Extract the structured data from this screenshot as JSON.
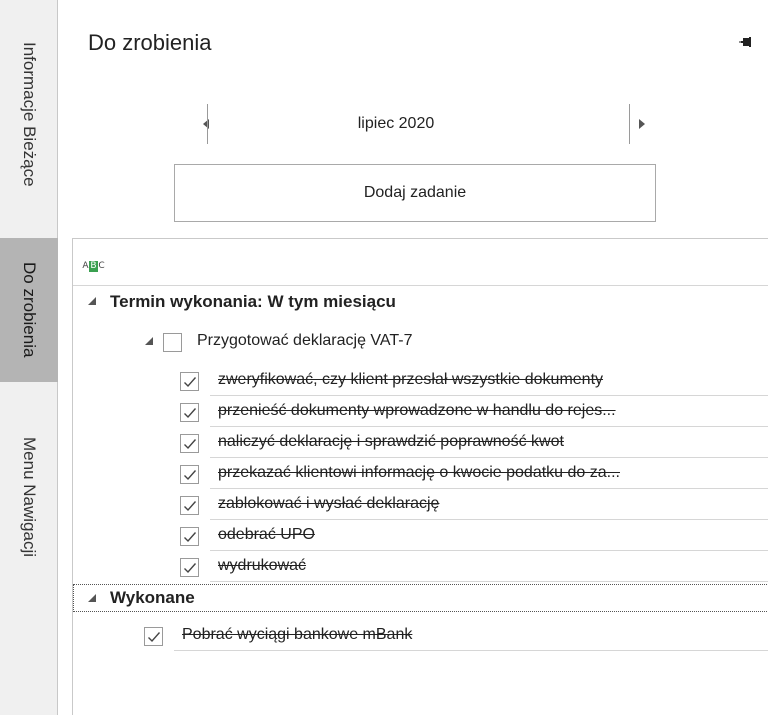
{
  "side_tabs": [
    "Informacje Bieżące",
    "Do zrobienia",
    "Menu Nawigacji"
  ],
  "panel": {
    "title": "Do zrobienia",
    "month": "lipiec 2020",
    "add_button": "Dodaj zadanie"
  },
  "grid": {
    "header_icon": "abc-sort-icon",
    "groups": [
      {
        "label": "Termin wykonania: W tym miesiącu",
        "task": "Przygotować deklarację VAT-7",
        "subtasks": [
          "zweryfikować, czy klient przesłał wszystkie dokumenty",
          "przenieść dokumenty wprowadzone w handlu do rejes...",
          "naliczyć deklarację i sprawdzić poprawność kwot",
          "przekazać klientowi informację o kwocie podatku do za...",
          "zablokować i wysłać deklarację",
          "odebrać UPO",
          "wydrukować"
        ]
      },
      {
        "label": "Wykonane",
        "task": "Pobrać wyciągi bankowe mBank"
      }
    ]
  },
  "colors": {
    "active_tab": "#b4b4b4",
    "tab_strip": "#f0f0f0",
    "abc_icon_green": "#3aa050"
  }
}
